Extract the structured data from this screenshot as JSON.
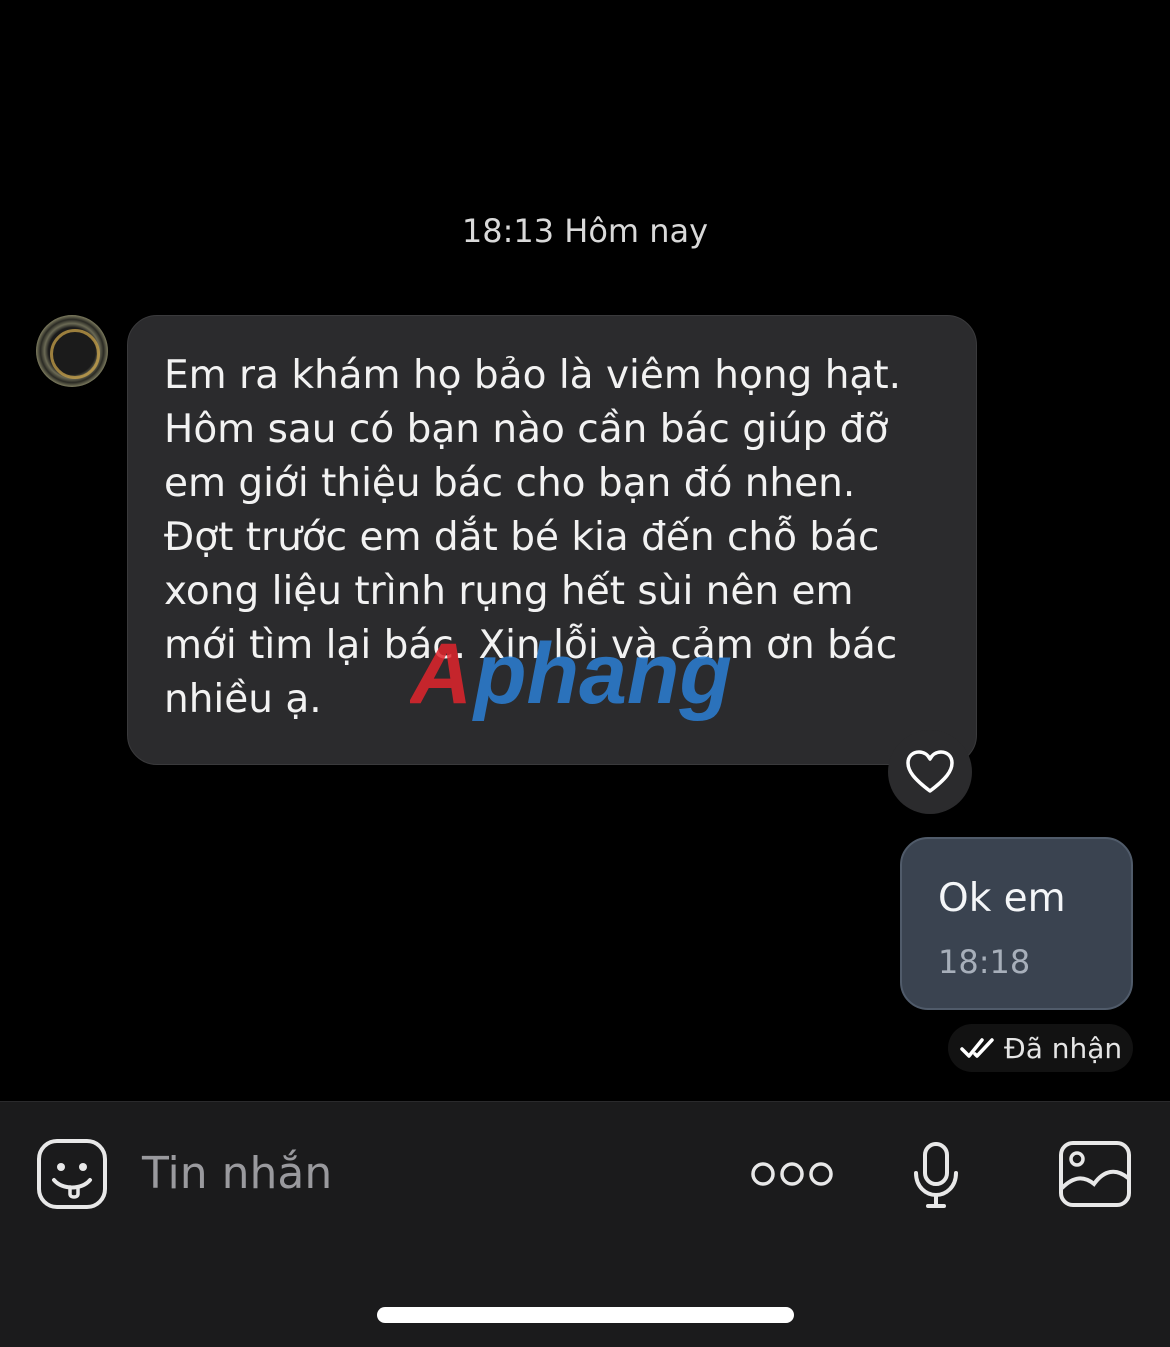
{
  "chat": {
    "timestamp_header": "18:13 Hôm nay",
    "incoming": {
      "text": "Em ra khám họ bảo là viêm họng hạt.\nHôm sau có bạn nào cần bác giúp đỡ\nem giới thiệu bác cho bạn đó nhen.\nĐợt trước em dắt bé kia đến chỗ bác\nxong liệu trình rụng hết sùi nên em\nmới tìm lại bác. Xin lỗi và cảm ơn bác\nnhiều ạ."
    },
    "outgoing": {
      "text": "Ok em",
      "time": "18:18",
      "status": "Đã nhận"
    },
    "watermark": "Aphang"
  },
  "composer": {
    "placeholder": "Tin nhắn"
  },
  "icons": {
    "avatar": "contact-avatar",
    "reaction": "heart-icon",
    "status": "double-check-icon",
    "sticker": "sticker-icon",
    "more": "more-icon",
    "voice": "microphone-icon",
    "gallery": "image-icon"
  }
}
